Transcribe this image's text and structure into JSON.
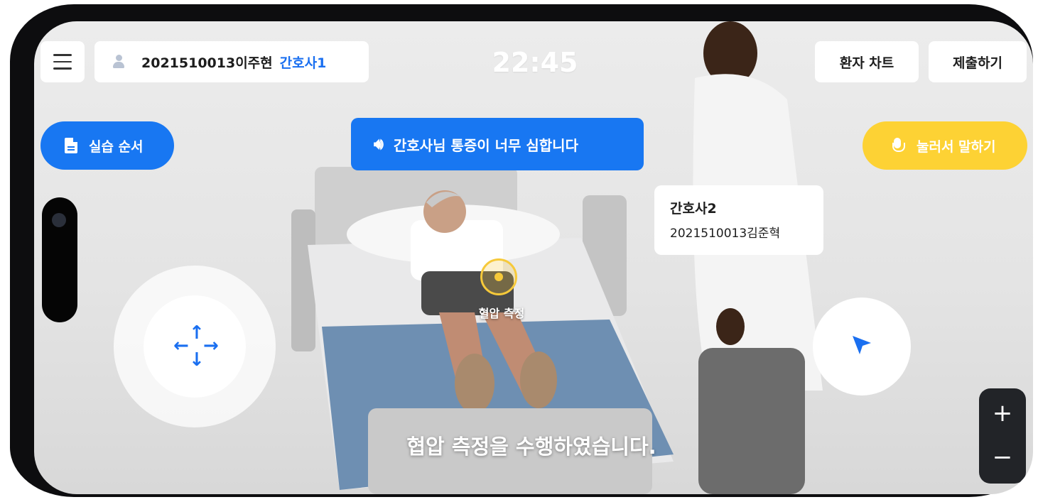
{
  "header": {
    "user_id": "2021510013이주현",
    "user_role": "간호사1",
    "clock": "22:45",
    "chart_button": "환자 차트",
    "submit_button": "제출하기"
  },
  "controls": {
    "guide_button": "실습 순서",
    "speech_text": "간호사님 통증이 너무 심합니다",
    "mic_button": "눌러서 말하기",
    "zoom_in": "+",
    "zoom_out": "−"
  },
  "nurse2": {
    "role": "간호사2",
    "id": "2021510013김준혁"
  },
  "scene": {
    "hotspot_label": "혈압 측정",
    "subtitle": "협압 측정을 수행하였습니다."
  },
  "colors": {
    "primary_blue": "#1877f2",
    "mic_yellow": "#fdd234",
    "hotspot_yellow": "#f6c93a"
  }
}
